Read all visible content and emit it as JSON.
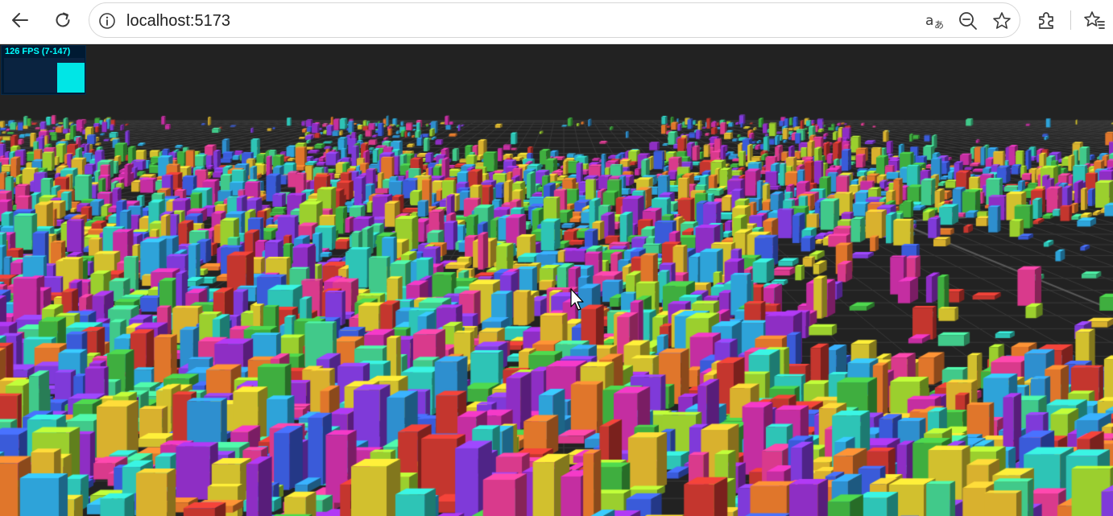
{
  "browser": {
    "url": "localhost:5173",
    "icons": {
      "back": "back-arrow-icon",
      "reload": "reload-icon",
      "site_info": "info-icon",
      "translate": "translate-icon",
      "zoom": "zoom-out-icon",
      "favorite": "star-icon",
      "extensions": "puzzle-icon",
      "favorites_bar": "favorites-icon"
    }
  },
  "stats": {
    "label": "126 FPS (7-147)",
    "fps": 126,
    "min": 7,
    "max": 147,
    "color": "#00ffff",
    "background": "#001a33"
  },
  "scene": {
    "background": "#222222",
    "grid_color": "#3a3a3a",
    "palette": [
      "#8e2ec4",
      "#2ec4b6",
      "#d2c02e",
      "#3a5bd9",
      "#d93a8c",
      "#3fae3f",
      "#e0762b",
      "#2ea3d9",
      "#c4362e",
      "#7f3ad9",
      "#9bcf2e",
      "#d9b12e",
      "#2e8fcf",
      "#c42ea1",
      "#41c98a"
    ]
  }
}
